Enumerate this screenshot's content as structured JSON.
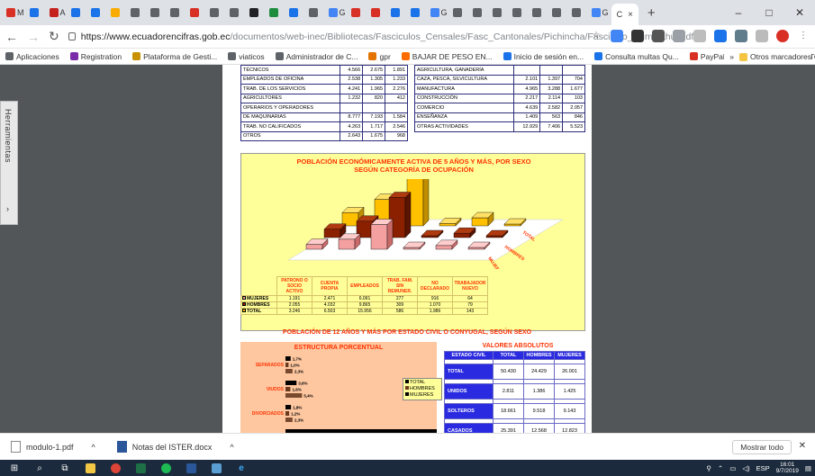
{
  "browser": {
    "tabs": [
      {
        "label": "M",
        "color": "#d93025"
      },
      {
        "label": "",
        "color": "#1a73e8"
      },
      {
        "label": "A",
        "color": "#c5221f"
      },
      {
        "label": "",
        "color": "#1a73e8"
      },
      {
        "label": "",
        "color": "#1a73e8"
      },
      {
        "label": "",
        "color": "#f9ab00"
      },
      {
        "label": "",
        "color": "#5f6368"
      },
      {
        "label": "",
        "color": "#5f6368"
      },
      {
        "label": "",
        "color": "#5f6368"
      },
      {
        "label": "",
        "color": "#d93025"
      },
      {
        "label": "",
        "color": "#5f6368"
      },
      {
        "label": "",
        "color": "#5f6368"
      },
      {
        "label": "",
        "color": "#202124"
      },
      {
        "label": "",
        "color": "#1e8e3e"
      },
      {
        "label": "",
        "color": "#1a73e8"
      },
      {
        "label": "",
        "color": "#5f6368"
      },
      {
        "label": "G",
        "color": "#4285f4"
      },
      {
        "label": "",
        "color": "#d93025"
      },
      {
        "label": "",
        "color": "#d93025"
      },
      {
        "label": "",
        "color": "#1a73e8"
      },
      {
        "label": "",
        "color": "#1a73e8"
      },
      {
        "label": "G",
        "color": "#4285f4"
      },
      {
        "label": "",
        "color": "#5f6368"
      },
      {
        "label": "",
        "color": "#5f6368"
      },
      {
        "label": "",
        "color": "#5f6368"
      },
      {
        "label": "",
        "color": "#5f6368"
      },
      {
        "label": "",
        "color": "#5f6368"
      },
      {
        "label": "",
        "color": "#5f6368"
      },
      {
        "label": "",
        "color": "#5f6368"
      },
      {
        "label": "G",
        "color": "#4285f4"
      }
    ],
    "active_tab_label": "C",
    "close_symbol": "×",
    "new_tab_symbol": "+",
    "window_controls": [
      "–",
      "□",
      "✕"
    ],
    "url_host": "https://www.ecuadorencifras.gob.ec",
    "url_path": "/documentos/web-inec/Bibliotecas/Fasciculos_Censales/Fasc_Cantonales/Pichincha/Fasciculo_Ruminahui.pdf",
    "bookmarks": [
      {
        "label": "Aplicaciones",
        "color": "#5f6368"
      },
      {
        "label": "Registration",
        "color": "#7b2ca8"
      },
      {
        "label": "Plataforma de Gesti...",
        "color": "#c79100"
      },
      {
        "label": "viaticos",
        "color": "#5f6368"
      },
      {
        "label": "Administrador de C...",
        "color": "#5f6368"
      },
      {
        "label": "gpr",
        "color": "#e37400"
      },
      {
        "label": "BAJAR DE PESO EN...",
        "color": "#ff6d00"
      },
      {
        "label": "Inicio de sesión en...",
        "color": "#1a73e8"
      },
      {
        "label": "Consulta multas Qu...",
        "color": "#1a73e8"
      },
      {
        "label": "PayPal",
        "color": "#d93025"
      },
      {
        "label": "INSTITUTO ECUATO...",
        "color": "#5f6368"
      },
      {
        "label": "Gmail",
        "color": "#5f6368"
      }
    ],
    "bookmarks_more": "»",
    "other_bookmarks": "Otros marcadores"
  },
  "pdf": {
    "sidebar_label": "Herramientas",
    "sidebar_arrow": "›",
    "occupation_table": [
      {
        "label": "TÉCNICOS",
        "v": [
          "4.566",
          "2.675",
          "1.891"
        ]
      },
      {
        "label": "EMPLEADOS DE OFICINA",
        "v": [
          "2.538",
          "1.305",
          "1.233"
        ]
      },
      {
        "label": "TRAB. DE LOS SERVICIOS",
        "v": [
          "4.241",
          "1.965",
          "2.276"
        ]
      },
      {
        "label": "AGRICULTORES",
        "v": [
          "1.232",
          "820",
          "412"
        ]
      },
      {
        "label": "OPERARIOS Y OPERADORES",
        "v": [
          "",
          "",
          ""
        ]
      },
      {
        "label": "DE MAQUINARIAS",
        "v": [
          "8.777",
          "7.193",
          "1.584"
        ]
      },
      {
        "label": "TRAB. NO CALIFICADOS",
        "v": [
          "4.263",
          "1.717",
          "2.546"
        ]
      },
      {
        "label": "OTROS",
        "v": [
          "2.643",
          "1.675",
          "968"
        ]
      }
    ],
    "activity_table": [
      {
        "label": "AGRICULTURA, GANADERÍA",
        "v": [
          "",
          "",
          ""
        ]
      },
      {
        "label": "CAZA, PESCA, SILVICULTURA",
        "v": [
          "2.101",
          "1.397",
          "704"
        ]
      },
      {
        "label": "MANUFACTURA",
        "v": [
          "4.965",
          "3.288",
          "1.677"
        ]
      },
      {
        "label": "CONSTRUCCIÓN",
        "v": [
          "2.217",
          "2.114",
          "103"
        ]
      },
      {
        "label": "COMERCIO",
        "v": [
          "4.639",
          "2.582",
          "2.057"
        ]
      },
      {
        "label": "ENSEÑANZA",
        "v": [
          "1.409",
          "563",
          "846"
        ]
      },
      {
        "label": "OTRAS ACTIVIDADES",
        "v": [
          "12.929",
          "7.406",
          "5.523"
        ]
      }
    ],
    "chart_title_1": "POBLACIÓN ECONÓMICAMENTE ACTIVA DE 5 AÑOS Y MÁS, POR SEXO",
    "chart_title_2": "SEGÚN CATEGORÍA DE OCUPACIÓN",
    "chart_axis_labels": [
      "TOTAL",
      "HOMBRES",
      "MUJERES"
    ],
    "category_table": {
      "headers": [
        "PATRONO O SOCIO ACTIVO",
        "CUENTA PROPIA",
        "EMPLEADOS",
        "TRAB. FAM. SIN REMUNER.",
        "NO DECLARADO",
        "TRABAJADOR NUEVO"
      ],
      "rows": [
        {
          "label": "MUJERES",
          "color": "#f4a0a0",
          "v": [
            "1.191",
            "2.471",
            "6.091",
            "277",
            "916",
            "64"
          ]
        },
        {
          "label": "HOMBRES",
          "color": "#8b2000",
          "v": [
            "2.055",
            "4.032",
            "9.865",
            "309",
            "1.070",
            "79"
          ]
        },
        {
          "label": "TOTAL",
          "color": "#ffc000",
          "v": [
            "3.246",
            "6.503",
            "15.956",
            "586",
            "1.986",
            "143"
          ]
        }
      ]
    },
    "section_title": "POBLACIÓN DE 12 AÑOS Y MÁS POR ESTADO CIVIL O CONYUGAL, SEGÚN SEXO",
    "structure_title": "ESTRUCTURA PORCENTUAL",
    "structure_groups": [
      {
        "label": "SEPARADOS",
        "pct": [
          "1,7%",
          "1,0%",
          "2,3%"
        ],
        "v": [
          1.7,
          1.0,
          2.3
        ]
      },
      {
        "label": "VIUDOS",
        "pct": [
          "3,6%",
          "1,6%",
          "5,4%"
        ],
        "v": [
          3.6,
          1.6,
          5.4
        ]
      },
      {
        "label": "DIVORCIADOS",
        "pct": [
          "1,8%",
          "1,2%",
          "2,3%"
        ],
        "v": [
          1.8,
          1.2,
          2.3
        ]
      },
      {
        "label": "",
        "pct": [
          "50,3%"
        ],
        "v": [
          50.3
        ]
      }
    ],
    "structure_legend": [
      "TOTAL",
      "HOMBRES",
      "MUJERES"
    ],
    "abs_title": "VALORES ABSOLUTOS",
    "abs_headers": [
      "ESTADO CIVIL",
      "TOTAL",
      "HOMBRES",
      "MUJERES"
    ],
    "abs_rows": [
      {
        "label": "TOTAL",
        "v": [
          "50.430",
          "24.429",
          "26.001"
        ]
      },
      {
        "label": "UNIDOS",
        "v": [
          "2.811",
          "1.386",
          "1.425"
        ]
      },
      {
        "label": "SOLTEROS",
        "v": [
          "18.661",
          "9.518",
          "9.143"
        ]
      },
      {
        "label": "CASADOS",
        "v": [
          "25.391",
          "12.568",
          "12.823"
        ]
      }
    ]
  },
  "chart_data": {
    "type": "bar",
    "title": "POBLACIÓN ECONÓMICAMENTE ACTIVA DE 5 AÑOS Y MÁS, POR SEXO SEGÚN CATEGORÍA DE OCUPACIÓN",
    "categories": [
      "PATRONO O SOCIO ACTIVO",
      "CUENTA PROPIA",
      "EMPLEADOS",
      "TRAB. FAM. SIN REMUNER.",
      "NO DECLARADO",
      "TRABAJADOR NUEVO"
    ],
    "series": [
      {
        "name": "MUJERES",
        "values": [
          1191,
          2471,
          6091,
          277,
          916,
          64
        ]
      },
      {
        "name": "HOMBRES",
        "values": [
          2055,
          4032,
          9865,
          309,
          1070,
          79
        ]
      },
      {
        "name": "TOTAL",
        "values": [
          3246,
          6503,
          15956,
          586,
          1986,
          143
        ]
      }
    ]
  },
  "downloads": {
    "items": [
      "modulo-1.pdf",
      "Notas del ISTER.docx"
    ],
    "show_all": "Mostrar todo",
    "close": "✕",
    "chevron": "^"
  },
  "taskbar": {
    "tray_lang": "ESP",
    "time": "16:01",
    "date": "9/7/2019"
  }
}
